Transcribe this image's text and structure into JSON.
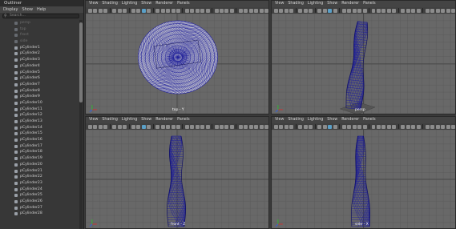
{
  "outliner": {
    "title": "Outliner",
    "menu": [
      "Display",
      "Show",
      "Help"
    ],
    "search_placeholder": "Search...",
    "items": [
      {
        "label": "persp",
        "dim": true
      },
      {
        "label": "top",
        "dim": true
      },
      {
        "label": "front",
        "dim": true
      },
      {
        "label": "side",
        "dim": true
      },
      {
        "label": "pCylinder1"
      },
      {
        "label": "pCylinder2"
      },
      {
        "label": "pCylinder3"
      },
      {
        "label": "pCylinder4"
      },
      {
        "label": "pCylinder5"
      },
      {
        "label": "pCylinder6"
      },
      {
        "label": "pCylinder7"
      },
      {
        "label": "pCylinder8"
      },
      {
        "label": "pCylinder9"
      },
      {
        "label": "pCylinder10"
      },
      {
        "label": "pCylinder11"
      },
      {
        "label": "pCylinder12"
      },
      {
        "label": "pCylinder13"
      },
      {
        "label": "pCylinder14"
      },
      {
        "label": "pCylinder15"
      },
      {
        "label": "pCylinder16"
      },
      {
        "label": "pCylinder17"
      },
      {
        "label": "pCylinder18"
      },
      {
        "label": "pCylinder19"
      },
      {
        "label": "pCylinder20"
      },
      {
        "label": "pCylinder21"
      },
      {
        "label": "pCylinder22"
      },
      {
        "label": "pCylinder23"
      },
      {
        "label": "pCylinder24"
      },
      {
        "label": "pCylinder25"
      },
      {
        "label": "pCylinder26"
      },
      {
        "label": "pCylinder27"
      },
      {
        "label": "pCylinder28"
      }
    ]
  },
  "viewports": [
    {
      "id": "top",
      "label": "top - Y",
      "menu": [
        "View",
        "Shading",
        "Lighting",
        "Show",
        "Renderer",
        "Panels"
      ]
    },
    {
      "id": "persp",
      "label": "persp",
      "menu": [
        "View",
        "Shading",
        "Lighting",
        "Show",
        "Renderer",
        "Panels"
      ]
    },
    {
      "id": "front",
      "label": "front - Z",
      "menu": [
        "View",
        "Shading",
        "Lighting",
        "Show",
        "Renderer",
        "Panels"
      ]
    },
    {
      "id": "side",
      "label": "side - X",
      "menu": [
        "View",
        "Shading",
        "Lighting",
        "Show",
        "Renderer",
        "Panels"
      ]
    }
  ],
  "colors": {
    "wire": "#1e1e9a",
    "viewport_bg": "#686868",
    "grid": "#5a5a5a",
    "axis_x": "#d03030",
    "axis_y": "#30c030",
    "axis_z": "#3060e0"
  }
}
